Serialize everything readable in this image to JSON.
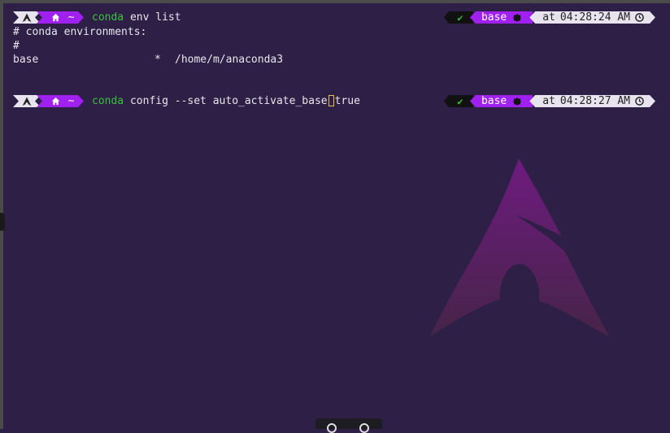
{
  "icons": {
    "os": "arch-linux-icon",
    "home": "home-icon",
    "env": "python-env-icon",
    "clock": "clock-icon",
    "status": "checkmark-icon"
  },
  "colors": {
    "background": "#2d1f45",
    "accent": "#a020f0",
    "command": "#39c23d",
    "segment_light": "#e8e4ef"
  },
  "prompt1": {
    "dir": "~",
    "cmd_name": "conda",
    "cmd_args": " env list",
    "status": "✔",
    "env": "base",
    "time_prefix": "at",
    "time": "04:28:24 AM"
  },
  "output": {
    "line1": "# conda environments:",
    "line2": "#",
    "env_name": "base",
    "env_active": "*",
    "env_path": "/home/m/anaconda3"
  },
  "prompt2": {
    "dir": "~",
    "cmd_name": "conda",
    "cmd_args_before": " config --set auto_activate_base",
    "cmd_args_after": "true",
    "status": "✔",
    "env": "base",
    "time_prefix": "at",
    "time": "04:28:27 AM"
  }
}
